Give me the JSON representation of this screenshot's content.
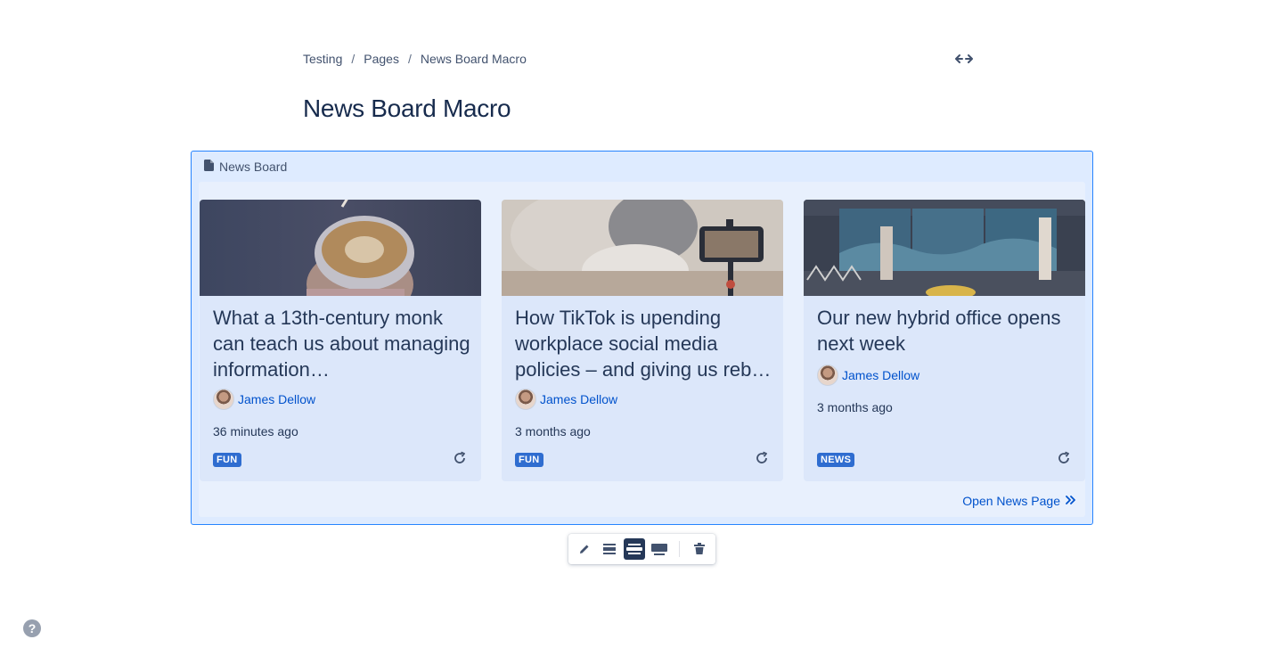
{
  "breadcrumb": {
    "items": [
      "Testing",
      "Pages",
      "News Board Macro"
    ],
    "separator": "/"
  },
  "width_toggle_icon": "expand-width-icon",
  "page": {
    "title": "News Board Macro"
  },
  "macro": {
    "label": "News Board",
    "icon": "page-icon",
    "cards": [
      {
        "title": "What a 13th-century monk can teach us about managing information…",
        "author": "James Dellow",
        "time": "36 minutes ago",
        "tag": "FUN",
        "image": "latte-art-photo",
        "refresh_icon": "refresh-icon"
      },
      {
        "title": "How TikTok is upending workplace social media policies – and giving us reb…",
        "author": "James Dellow",
        "time": "3 months ago",
        "tag": "FUN",
        "image": "phone-on-tripod-photo",
        "refresh_icon": "refresh-icon"
      },
      {
        "title": "Our new hybrid office opens next week",
        "author": "James Dellow",
        "time": "3 months ago",
        "tag": "NEWS",
        "image": "office-screens-photo",
        "refresh_icon": "refresh-icon"
      }
    ],
    "open_link": "Open News Page"
  },
  "toolbar": {
    "buttons": [
      "edit-icon",
      "center-layout-icon",
      "wide-layout-icon",
      "full-width-layout-icon",
      "delete-icon"
    ],
    "active": "wide-layout-icon"
  },
  "help": {
    "label": "?"
  },
  "colors": {
    "accent": "#0052CC",
    "tag": "#2F6DD0",
    "selection_border": "#2684FF",
    "selection_bg": "#DEEBFF"
  }
}
